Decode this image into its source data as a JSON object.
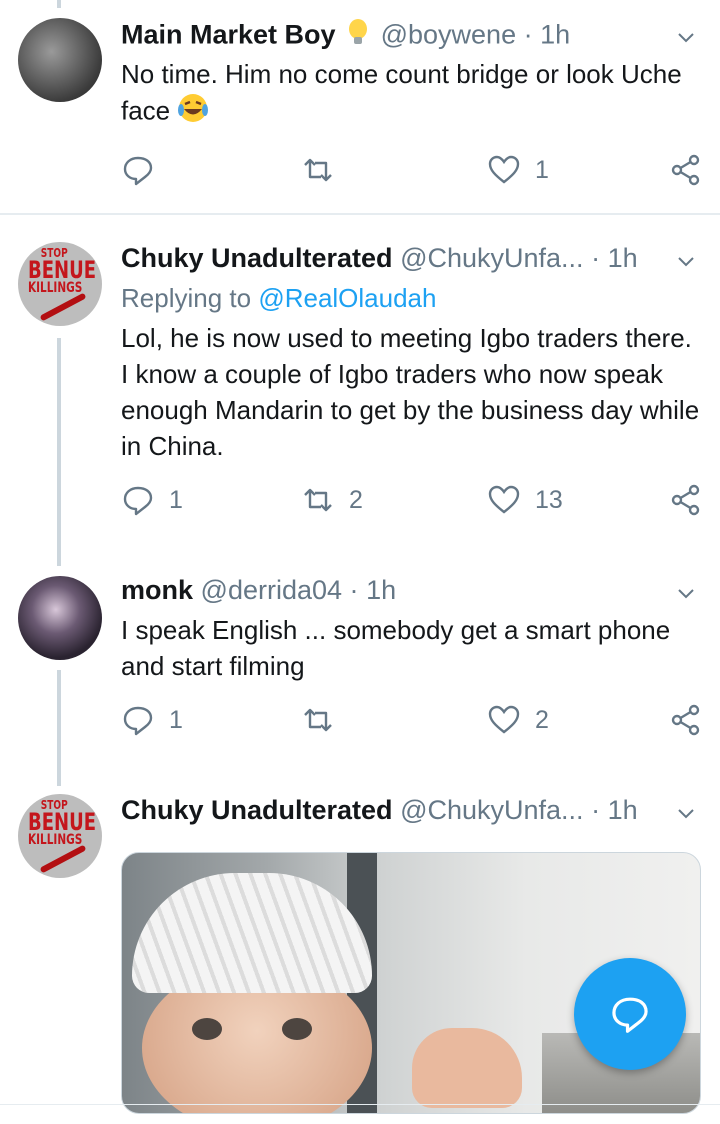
{
  "tweets": [
    {
      "name": "Main Market Boy",
      "badge_icon": "lightbulb-emoji",
      "handle": "@boywene",
      "time": "1h",
      "text": "No time. Him no come count bridge or look Uche face",
      "emoji": "face-with-tears-of-joy",
      "replies": "",
      "retweets": "",
      "likes": "1"
    },
    {
      "name": "Chuky Unadulterated",
      "handle": "@ChukyUnfa...",
      "time": "1h",
      "replying_label": "Replying to",
      "replying_to": "@RealOlaudah",
      "text": "Lol, he is now used to meeting Igbo traders there. I know a couple of Igbo traders who now speak enough Mandarin to get by the business day while in China.",
      "replies": "1",
      "retweets": "2",
      "likes": "13"
    },
    {
      "name": "monk",
      "handle": "@derrida04",
      "time": "1h",
      "text": "I speak English ... somebody get a smart phone and start filming",
      "replies": "1",
      "retweets": "",
      "likes": "2"
    },
    {
      "name": "Chuky Unadulterated",
      "handle": "@ChukyUnfa...",
      "time": "1h"
    }
  ],
  "avatar_benue": {
    "line1": "STOP",
    "line2": "BENUE",
    "line3": "KILLINGS"
  },
  "separator": "·",
  "colors": {
    "accent": "#1da1f2",
    "secondary_text": "#657786",
    "divider": "#e6ecf0"
  }
}
